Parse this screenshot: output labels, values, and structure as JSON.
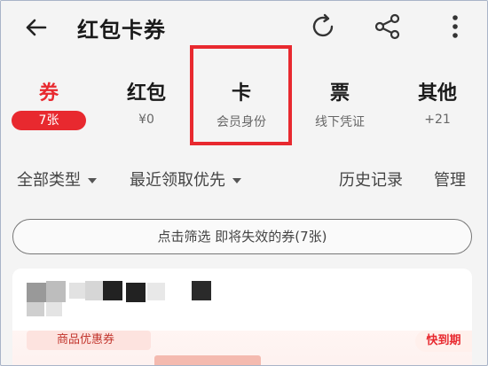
{
  "header": {
    "title": "红包卡券",
    "back_icon": "arrow-left-icon",
    "refresh_icon": "refresh-icon",
    "share_icon": "share-icon",
    "more_icon": "more-vertical-icon"
  },
  "tabs": [
    {
      "label": "券",
      "badge": "7张",
      "active": true
    },
    {
      "label": "红包",
      "sub": "¥0"
    },
    {
      "label": "卡",
      "sub": "会员身份",
      "highlighted": true
    },
    {
      "label": "票",
      "sub": "线下凭证"
    },
    {
      "label": "其他",
      "sub": "+21"
    }
  ],
  "filters": {
    "type": "全部类型",
    "sort": "最近领取优先",
    "history": "历史记录",
    "manage": "管理"
  },
  "pill": {
    "label": "点击筛选 即将失效的券(7张)"
  },
  "card": {
    "tag": "商品优惠券",
    "expire": "快到期"
  },
  "colors": {
    "accent": "#e8292f",
    "highlight": "#e8292f"
  }
}
